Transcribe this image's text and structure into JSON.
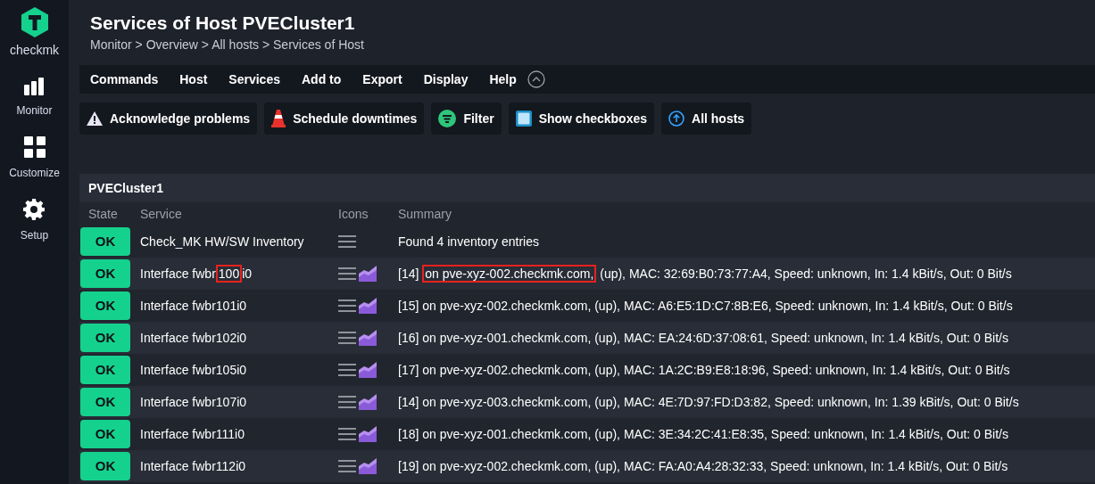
{
  "sidebar": {
    "logo_text": "checkmk",
    "items": [
      {
        "kind": "monitor",
        "label": "Monitor"
      },
      {
        "kind": "customize",
        "label": "Customize"
      },
      {
        "kind": "setup",
        "label": "Setup"
      }
    ]
  },
  "title": "Services of Host PVECluster1",
  "breadcrumb": "Monitor > Overview > All hosts > Services of Host",
  "menu": [
    "Commands",
    "Host",
    "Services",
    "Add to",
    "Export",
    "Display",
    "Help"
  ],
  "actions": [
    {
      "kind": "warning",
      "label": "Acknowledge problems"
    },
    {
      "kind": "cone",
      "label": "Schedule downtimes"
    },
    {
      "kind": "filter",
      "label": "Filter"
    },
    {
      "kind": "checkbox",
      "label": "Show checkboxes"
    },
    {
      "kind": "up",
      "label": "All hosts"
    }
  ],
  "table": {
    "host": "PVECluster1",
    "columns": [
      "State",
      "Service",
      "Icons",
      "Summary"
    ],
    "rows": [
      {
        "state": "OK",
        "service": [
          {
            "text": "Check_MK HW/SW Inventory",
            "highlighted": false
          }
        ],
        "graph": false,
        "summary": [
          {
            "text": "Found 4 inventory entries",
            "highlighted": false
          }
        ]
      },
      {
        "state": "OK",
        "service": [
          {
            "text": "Interface fwbr",
            "highlighted": false
          },
          {
            "text": "100",
            "highlighted": true
          },
          {
            "text": "i0",
            "highlighted": false
          }
        ],
        "graph": true,
        "summary": [
          {
            "text": "[14] ",
            "highlighted": false
          },
          {
            "text": "on pve-xyz-002.checkmk.com,",
            "highlighted": true
          },
          {
            "text": " (up), MAC: 32:69:B0:73:77:A4, Speed: unknown, In: 1.4 kBit/s, Out: 0 Bit/s",
            "highlighted": false
          }
        ]
      },
      {
        "state": "OK",
        "service": [
          {
            "text": "Interface fwbr101i0",
            "highlighted": false
          }
        ],
        "graph": true,
        "summary": [
          {
            "text": "[15] on pve-xyz-002.checkmk.com, (up), MAC: A6:E5:1D:C7:8B:E6, Speed: unknown, In: 1.4 kBit/s, Out: 0 Bit/s",
            "highlighted": false
          }
        ]
      },
      {
        "state": "OK",
        "service": [
          {
            "text": "Interface fwbr102i0",
            "highlighted": false
          }
        ],
        "graph": true,
        "summary": [
          {
            "text": "[16] on pve-xyz-001.checkmk.com, (up), MAC: EA:24:6D:37:08:61, Speed: unknown, In: 1.4 kBit/s, Out: 0 Bit/s",
            "highlighted": false
          }
        ]
      },
      {
        "state": "OK",
        "service": [
          {
            "text": "Interface fwbr105i0",
            "highlighted": false
          }
        ],
        "graph": true,
        "summary": [
          {
            "text": "[17] on pve-xyz-002.checkmk.com, (up), MAC: 1A:2C:B9:E8:18:96, Speed: unknown, In: 1.4 kBit/s, Out: 0 Bit/s",
            "highlighted": false
          }
        ]
      },
      {
        "state": "OK",
        "service": [
          {
            "text": "Interface fwbr107i0",
            "highlighted": false
          }
        ],
        "graph": true,
        "summary": [
          {
            "text": "[14] on pve-xyz-003.checkmk.com, (up), MAC: 4E:7D:97:FD:D3:82, Speed: unknown, In: 1.39 kBit/s, Out: 0 Bit/s",
            "highlighted": false
          }
        ]
      },
      {
        "state": "OK",
        "service": [
          {
            "text": "Interface fwbr111i0",
            "highlighted": false
          }
        ],
        "graph": true,
        "summary": [
          {
            "text": "[18] on pve-xyz-001.checkmk.com, (up), MAC: 3E:34:2C:41:E8:35, Speed: unknown, In: 1.4 kBit/s, Out: 0 Bit/s",
            "highlighted": false
          }
        ]
      },
      {
        "state": "OK",
        "service": [
          {
            "text": "Interface fwbr112i0",
            "highlighted": false
          }
        ],
        "graph": true,
        "summary": [
          {
            "text": "[19] on pve-xyz-002.checkmk.com, (up), MAC: FA:A0:A4:28:32:33, Speed: unknown, In: 1.4 kBit/s, Out: 0 Bit/s",
            "highlighted": false
          }
        ]
      }
    ]
  }
}
